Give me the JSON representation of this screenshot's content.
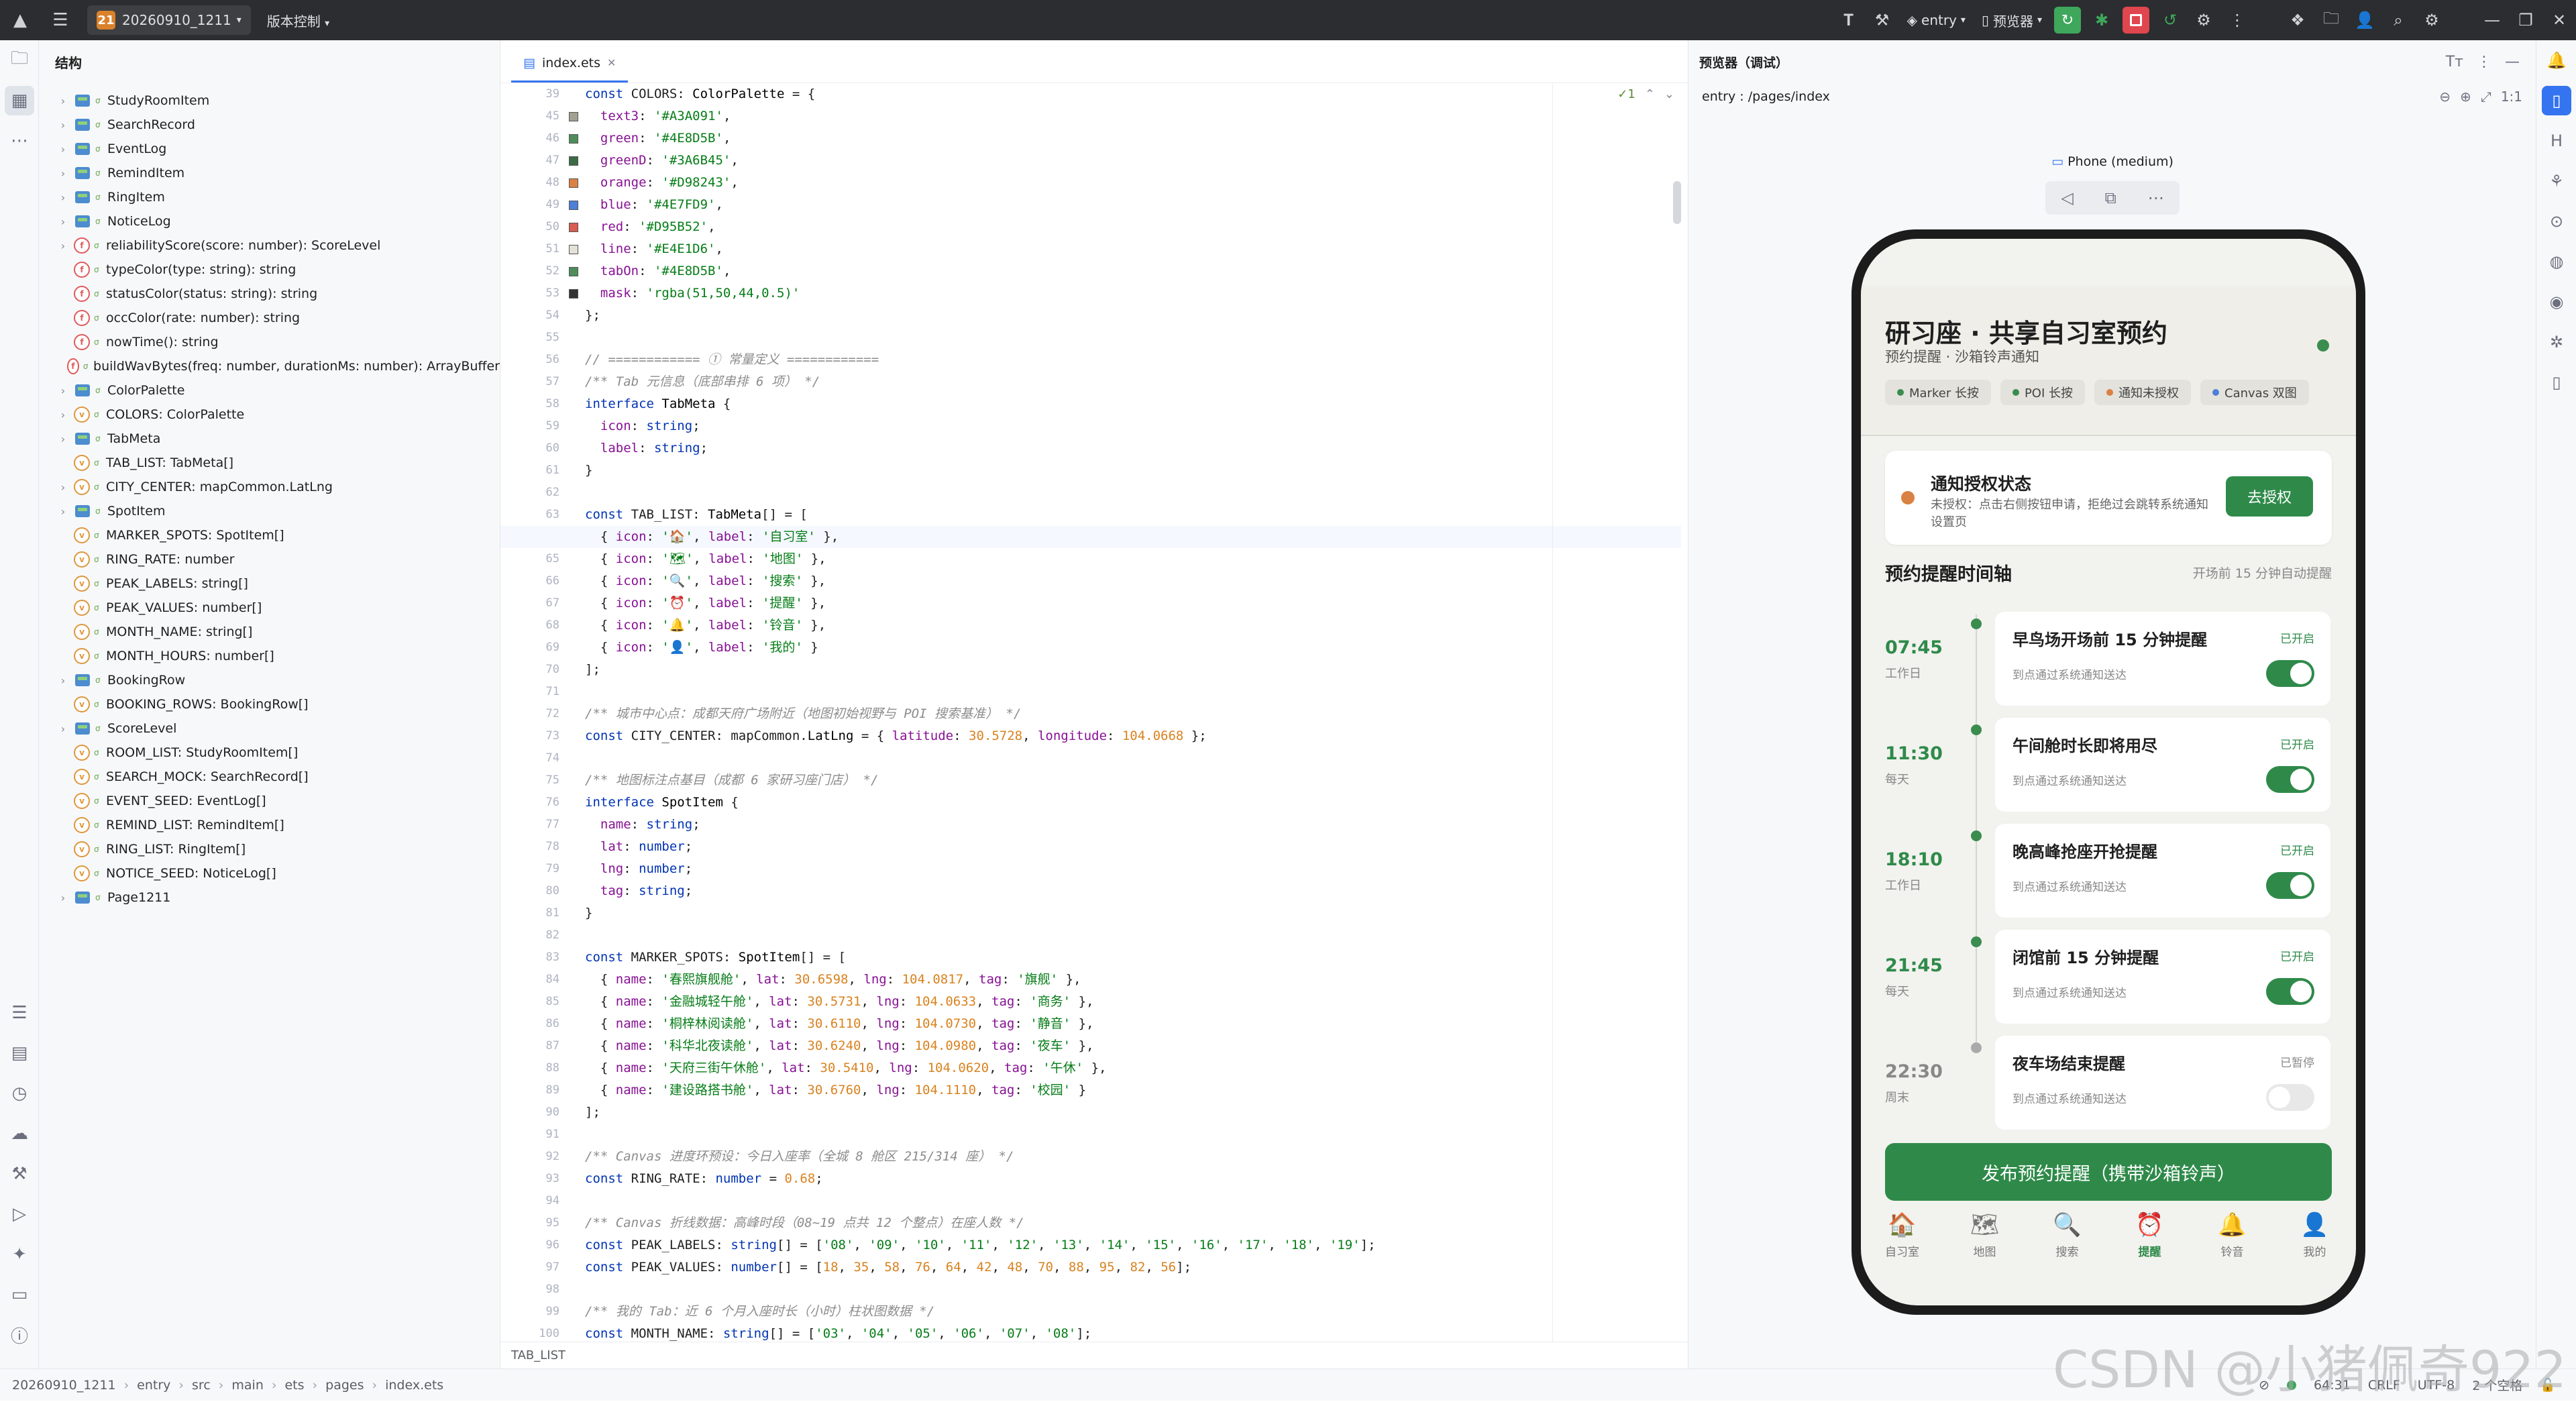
{
  "titlebar": {
    "project_badge": "21",
    "project_name": "20260910_1211",
    "vcs": "版本控制",
    "run_config": "entry",
    "previewer": "预览器"
  },
  "structure": {
    "title": "结构",
    "items": [
      {
        "label": "StudyRoomItem",
        "kind": "iface",
        "chev": true
      },
      {
        "label": "SearchRecord",
        "kind": "iface",
        "chev": true
      },
      {
        "label": "EventLog",
        "kind": "iface",
        "chev": true
      },
      {
        "label": "RemindItem",
        "kind": "iface",
        "chev": true
      },
      {
        "label": "RingItem",
        "kind": "iface",
        "chev": true
      },
      {
        "label": "NoticeLog",
        "kind": "iface",
        "chev": true
      },
      {
        "label": "reliabilityScore(score: number): ScoreLevel",
        "kind": "fn",
        "chev": true
      },
      {
        "label": "typeColor(type: string): string",
        "kind": "fn",
        "chev": false
      },
      {
        "label": "statusColor(status: string): string",
        "kind": "fn",
        "chev": false
      },
      {
        "label": "occColor(rate: number): string",
        "kind": "fn",
        "chev": false
      },
      {
        "label": "nowTime(): string",
        "kind": "fn",
        "chev": false
      },
      {
        "label": "buildWavBytes(freq: number, durationMs: number): ArrayBuffer",
        "kind": "fn",
        "chev": false
      },
      {
        "label": "ColorPalette",
        "kind": "iface",
        "chev": true
      },
      {
        "label": "COLORS: ColorPalette",
        "kind": "var",
        "chev": true
      },
      {
        "label": "TabMeta",
        "kind": "iface",
        "chev": true
      },
      {
        "label": "TAB_LIST: TabMeta[]",
        "kind": "var",
        "chev": false
      },
      {
        "label": "CITY_CENTER: mapCommon.LatLng",
        "kind": "var",
        "chev": true
      },
      {
        "label": "SpotItem",
        "kind": "iface",
        "chev": true
      },
      {
        "label": "MARKER_SPOTS: SpotItem[]",
        "kind": "var",
        "chev": false
      },
      {
        "label": "RING_RATE: number",
        "kind": "var",
        "chev": false
      },
      {
        "label": "PEAK_LABELS: string[]",
        "kind": "var",
        "chev": false
      },
      {
        "label": "PEAK_VALUES: number[]",
        "kind": "var",
        "chev": false
      },
      {
        "label": "MONTH_NAME: string[]",
        "kind": "var",
        "chev": false
      },
      {
        "label": "MONTH_HOURS: number[]",
        "kind": "var",
        "chev": false
      },
      {
        "label": "BookingRow",
        "kind": "iface",
        "chev": true
      },
      {
        "label": "BOOKING_ROWS: BookingRow[]",
        "kind": "var",
        "chev": false
      },
      {
        "label": "ScoreLevel",
        "kind": "iface",
        "chev": true
      },
      {
        "label": "ROOM_LIST: StudyRoomItem[]",
        "kind": "var",
        "chev": false
      },
      {
        "label": "SEARCH_MOCK: SearchRecord[]",
        "kind": "var",
        "chev": false
      },
      {
        "label": "EVENT_SEED: EventLog[]",
        "kind": "var",
        "chev": false
      },
      {
        "label": "REMIND_LIST: RemindItem[]",
        "kind": "var",
        "chev": false
      },
      {
        "label": "RING_LIST: RingItem[]",
        "kind": "var",
        "chev": false
      },
      {
        "label": "NOTICE_SEED: NoticeLog[]",
        "kind": "var",
        "chev": false
      },
      {
        "label": "Page1211",
        "kind": "iface",
        "chev": true
      }
    ]
  },
  "editor": {
    "tab": "index.ets",
    "inspection": "✓1",
    "breadcrumb_bottom": "TAB_LIST",
    "current_line": 64,
    "swatches": {
      "45": "#A3A091",
      "46": "#4E8D5B",
      "47": "#3A6B45",
      "48": "#D98243",
      "49": "#4E7FD9",
      "50": "#D95B52",
      "51": "#E4E1D6",
      "52": "#4E8D5B",
      "53": "#333333"
    }
  },
  "preview": {
    "title": "预览器（调试）",
    "path": "entry : /pages/index",
    "device": "Phone (medium)",
    "app_title": "研习座 · 共享自习室预约",
    "app_sub": "预约提醒 · 沙箱铃声通知",
    "chips": [
      {
        "label": "Marker 长按",
        "color": "#3a8c4f"
      },
      {
        "label": "POI 长按",
        "color": "#3a8c4f"
      },
      {
        "label": "通知未授权",
        "color": "#d98243"
      },
      {
        "label": "Canvas 双图",
        "color": "#4e7fd9"
      }
    ],
    "auth": {
      "title": "通知授权状态",
      "text": "未授权：点击右侧按钮申请，拒绝过会跳转系统通知设置页",
      "button": "去授权"
    },
    "timeline_title": "预约提醒时间轴",
    "timeline_note": "开场前 15 分钟自动提醒",
    "reminders": [
      {
        "time": "07:45",
        "day": "工作日",
        "title": "早鸟场开场前 15 分钟提醒",
        "state": "已开启",
        "desc": "到点通过系统通知送达",
        "on": true
      },
      {
        "time": "11:30",
        "day": "每天",
        "title": "午间舱时长即将用尽",
        "state": "已开启",
        "desc": "到点通过系统通知送达",
        "on": true
      },
      {
        "time": "18:10",
        "day": "工作日",
        "title": "晚高峰抢座开抢提醒",
        "state": "已开启",
        "desc": "到点通过系统通知送达",
        "on": true
      },
      {
        "time": "21:45",
        "day": "每天",
        "title": "闭馆前 15 分钟提醒",
        "state": "已开启",
        "desc": "到点通过系统通知送达",
        "on": true
      },
      {
        "time": "22:30",
        "day": "周末",
        "title": "夜车场结束提醒",
        "state": "已暂停",
        "desc": "到点通过系统通知送达",
        "on": false
      }
    ],
    "publish": "发布预约提醒（携带沙箱铃声）",
    "tabs": [
      {
        "icon": "🏠",
        "label": "自习室",
        "on": false
      },
      {
        "icon": "🗺",
        "label": "地图",
        "on": false
      },
      {
        "icon": "🔍",
        "label": "搜索",
        "on": false
      },
      {
        "icon": "⏰",
        "label": "提醒",
        "on": true
      },
      {
        "icon": "🔔",
        "label": "铃音",
        "on": false
      },
      {
        "icon": "👤",
        "label": "我的",
        "on": false
      }
    ]
  },
  "statusbar": {
    "crumbs": [
      "20260910_1211",
      "entry",
      "src",
      "main",
      "ets",
      "pages",
      "index.ets"
    ],
    "position": "64:31",
    "line_sep": "CRLF",
    "encoding": "UTF-8",
    "indent": "2 个空格"
  },
  "watermark": "CSDN @小猪佩奇922"
}
